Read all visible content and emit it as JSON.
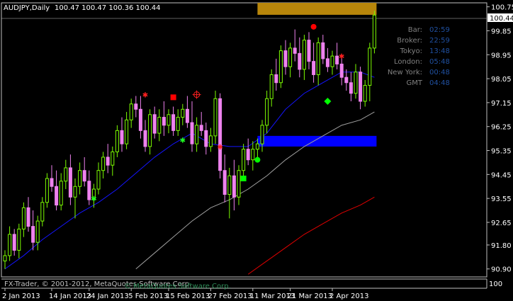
{
  "header": {
    "symbol_timeframe": "AUDJPY,Daily",
    "ohlc": "100.47 100.47 100.36 100.44"
  },
  "price_axis": {
    "ticks": [
      "100.75",
      "99.85",
      "98.95",
      "98.05",
      "97.15",
      "96.25",
      "95.35",
      "94.45",
      "93.55",
      "92.65",
      "91.80",
      "90.90"
    ],
    "current_price": "100.44"
  },
  "indicator_axis": {
    "label": "100"
  },
  "date_axis": {
    "labels": [
      "2 Jan 2013",
      "14 Jan 2013",
      "24 Jan 2013",
      "5 Feb 2013",
      "15 Feb 2013",
      "27 Feb 2013",
      "11 Mar 2013",
      "21 Mar 2013",
      "2 Apr 2013"
    ]
  },
  "info_panel": {
    "rows": [
      {
        "label": "Bar:",
        "value": "02:59"
      },
      {
        "label": "Broker:",
        "value": "22:59"
      },
      {
        "label": "Tokyo:",
        "value": "13:48"
      },
      {
        "label": "London:",
        "value": "05:48"
      },
      {
        "label": "New York:",
        "value": "00:48"
      },
      {
        "label": "GMT",
        "value": "04:48"
      }
    ]
  },
  "footer": {
    "copyright": "FX-Trader, © 2001-2012, MetaQuotes Software Corp.",
    "overlay_text": "© MetaQuotes Software Corp."
  },
  "colors": {
    "background": "#000000",
    "grid": "#c0c0c0",
    "text": "#ffffff",
    "bull_candle": "#7cfc00",
    "bear_candle": "#ee82ee",
    "ma_fast": "#1414ff",
    "ma_mid": "#a0a0a0",
    "ma_slow": "#e00000",
    "info_label": "#808080",
    "info_value": "#2050a0",
    "zone_resistance": "#b8860b",
    "zone_support": "#0000ff"
  },
  "chart_data": {
    "type": "candlestick",
    "ylim": [
      90.6,
      100.9
    ],
    "candles": [
      [
        91.2,
        91.6,
        90.9,
        91.4
      ],
      [
        91.4,
        92.5,
        91.2,
        92.2
      ],
      [
        92.2,
        92.4,
        91.4,
        91.6
      ],
      [
        91.6,
        92.6,
        91.3,
        92.4
      ],
      [
        92.4,
        93.4,
        92.1,
        93.2
      ],
      [
        93.2,
        93.6,
        92.3,
        92.5
      ],
      [
        92.5,
        93.1,
        91.6,
        91.9
      ],
      [
        91.9,
        92.9,
        91.6,
        92.7
      ],
      [
        92.7,
        93.6,
        92.5,
        93.4
      ],
      [
        93.4,
        94.5,
        93.2,
        94.3
      ],
      [
        94.3,
        94.8,
        93.8,
        94.0
      ],
      [
        94.0,
        94.6,
        93.1,
        93.3
      ],
      [
        93.3,
        94.5,
        93.1,
        94.2
      ],
      [
        94.2,
        95.0,
        93.9,
        94.7
      ],
      [
        94.7,
        95.2,
        93.3,
        93.6
      ],
      [
        93.6,
        94.3,
        92.8,
        94.0
      ],
      [
        94.0,
        94.9,
        93.7,
        94.6
      ],
      [
        94.6,
        95.1,
        94.0,
        94.2
      ],
      [
        94.2,
        94.6,
        93.3,
        93.5
      ],
      [
        93.5,
        94.1,
        93.2,
        93.9
      ],
      [
        93.9,
        94.9,
        93.7,
        94.6
      ],
      [
        94.6,
        95.3,
        94.3,
        95.1
      ],
      [
        95.1,
        95.6,
        94.5,
        94.8
      ],
      [
        94.8,
        95.5,
        94.4,
        95.3
      ],
      [
        95.3,
        96.3,
        95.1,
        96.1
      ],
      [
        96.1,
        96.6,
        95.3,
        95.6
      ],
      [
        95.6,
        96.8,
        95.4,
        96.5
      ],
      [
        96.5,
        97.3,
        96.2,
        97.1
      ],
      [
        97.1,
        97.4,
        96.6,
        96.9
      ],
      [
        96.9,
        97.4,
        95.8,
        96.1
      ],
      [
        96.1,
        96.5,
        95.3,
        95.5
      ],
      [
        95.5,
        96.9,
        95.2,
        96.7
      ],
      [
        96.7,
        97.0,
        95.8,
        96.0
      ],
      [
        96.0,
        96.9,
        95.7,
        96.6
      ],
      [
        96.6,
        97.2,
        95.9,
        96.3
      ],
      [
        96.3,
        96.9,
        96.0,
        96.7
      ],
      [
        96.7,
        97.0,
        95.9,
        96.1
      ],
      [
        96.1,
        96.9,
        95.9,
        96.6
      ],
      [
        96.6,
        97.1,
        96.3,
        96.9
      ],
      [
        96.9,
        97.4,
        96.2,
        96.4
      ],
      [
        96.4,
        97.2,
        95.3,
        95.6
      ],
      [
        95.6,
        96.6,
        95.3,
        96.3
      ],
      [
        96.3,
        96.8,
        95.9,
        96.1
      ],
      [
        96.1,
        96.4,
        95.2,
        95.5
      ],
      [
        95.5,
        96.2,
        95.3,
        95.9
      ],
      [
        95.9,
        97.6,
        95.6,
        97.3
      ],
      [
        97.3,
        97.5,
        94.3,
        94.6
      ],
      [
        94.6,
        95.2,
        93.4,
        93.7
      ],
      [
        93.7,
        94.7,
        92.8,
        94.4
      ],
      [
        94.4,
        95.0,
        93.1,
        93.6
      ],
      [
        93.6,
        94.8,
        93.3,
        94.6
      ],
      [
        94.6,
        95.6,
        94.3,
        95.4
      ],
      [
        95.4,
        95.8,
        94.8,
        95.0
      ],
      [
        95.0,
        95.7,
        94.6,
        95.4
      ],
      [
        95.4,
        95.8,
        95.1,
        95.6
      ],
      [
        95.6,
        96.5,
        95.3,
        96.3
      ],
      [
        96.3,
        97.6,
        96.0,
        97.3
      ],
      [
        97.3,
        98.4,
        97.0,
        98.2
      ],
      [
        98.2,
        98.8,
        97.6,
        97.9
      ],
      [
        97.9,
        99.3,
        97.7,
        99.1
      ],
      [
        99.1,
        99.5,
        98.2,
        98.5
      ],
      [
        98.5,
        99.4,
        98.1,
        99.2
      ],
      [
        99.2,
        99.9,
        98.7,
        99.0
      ],
      [
        99.0,
        99.6,
        98.1,
        98.4
      ],
      [
        98.4,
        99.7,
        98.0,
        99.5
      ],
      [
        99.5,
        99.8,
        98.4,
        98.7
      ],
      [
        98.7,
        99.4,
        97.9,
        98.2
      ],
      [
        98.2,
        99.6,
        97.8,
        99.4
      ],
      [
        99.4,
        99.7,
        98.6,
        98.8
      ],
      [
        98.8,
        99.2,
        98.3,
        98.5
      ],
      [
        98.5,
        99.1,
        98.2,
        98.9
      ],
      [
        98.9,
        99.4,
        98.4,
        98.6
      ],
      [
        98.6,
        98.9,
        97.8,
        98.1
      ],
      [
        98.1,
        98.4,
        97.6,
        97.9
      ],
      [
        97.9,
        98.3,
        97.2,
        97.5
      ],
      [
        97.5,
        98.6,
        97.3,
        98.3
      ],
      [
        98.3,
        98.5,
        96.9,
        97.2
      ],
      [
        97.2,
        98.0,
        97.0,
        97.8
      ],
      [
        97.8,
        99.4,
        97.2,
        99.2
      ],
      [
        99.2,
        100.6,
        99.0,
        100.44
      ]
    ],
    "ma_fast": [
      [
        0,
        90.9
      ],
      [
        4,
        91.4
      ],
      [
        8,
        92.0
      ],
      [
        12,
        92.5
      ],
      [
        16,
        93.0
      ],
      [
        20,
        93.4
      ],
      [
        24,
        93.9
      ],
      [
        28,
        94.5
      ],
      [
        32,
        95.1
      ],
      [
        36,
        95.6
      ],
      [
        40,
        96.0
      ],
      [
        44,
        95.6
      ],
      [
        48,
        95.5
      ],
      [
        52,
        95.5
      ],
      [
        56,
        96.0
      ],
      [
        60,
        96.9
      ],
      [
        64,
        97.5
      ],
      [
        68,
        97.9
      ],
      [
        72,
        98.3
      ],
      [
        76,
        98.3
      ],
      [
        79,
        98.1
      ]
    ],
    "ma_mid": [
      [
        28,
        90.9
      ],
      [
        32,
        91.5
      ],
      [
        36,
        92.1
      ],
      [
        40,
        92.7
      ],
      [
        44,
        93.2
      ],
      [
        48,
        93.5
      ],
      [
        52,
        93.9
      ],
      [
        56,
        94.4
      ],
      [
        60,
        95.0
      ],
      [
        64,
        95.5
      ],
      [
        68,
        95.9
      ],
      [
        72,
        96.3
      ],
      [
        76,
        96.5
      ],
      [
        79,
        96.8
      ]
    ],
    "ma_slow": [
      [
        52,
        90.7
      ],
      [
        56,
        91.2
      ],
      [
        60,
        91.7
      ],
      [
        64,
        92.2
      ],
      [
        68,
        92.6
      ],
      [
        72,
        93.0
      ],
      [
        76,
        93.3
      ],
      [
        79,
        93.6
      ]
    ],
    "zones": [
      {
        "name": "resistance",
        "start": 54,
        "end": 79,
        "top": 100.9,
        "bottom": 100.45
      },
      {
        "name": "support",
        "start": 54,
        "end": 79,
        "top": 95.9,
        "bottom": 95.5
      }
    ],
    "signals": [
      {
        "kind": "star",
        "i": 30,
        "price": 97.45,
        "color": "#ff2020"
      },
      {
        "kind": "square",
        "i": 36,
        "price": 97.35,
        "color": "#ff0000"
      },
      {
        "kind": "target",
        "i": 41,
        "price": 97.45,
        "color": "#ff2020"
      },
      {
        "kind": "star",
        "i": 38,
        "price": 95.75,
        "color": "#20ff20"
      },
      {
        "kind": "star",
        "i": 46,
        "price": 95.5,
        "color": "#ff2020"
      },
      {
        "kind": "star",
        "i": 19,
        "price": 93.55,
        "color": "#20ff20"
      },
      {
        "kind": "circle",
        "i": 54,
        "price": 95.0,
        "color": "#00ff00"
      },
      {
        "kind": "square",
        "i": 51,
        "price": 94.3,
        "color": "#00ff00"
      },
      {
        "kind": "circle",
        "i": 66,
        "price": 100.0,
        "color": "#ff0000"
      },
      {
        "kind": "star",
        "i": 72,
        "price": 98.9,
        "color": "#ff2020"
      },
      {
        "kind": "diamond",
        "i": 69,
        "price": 97.2,
        "color": "#00ff00"
      }
    ]
  }
}
